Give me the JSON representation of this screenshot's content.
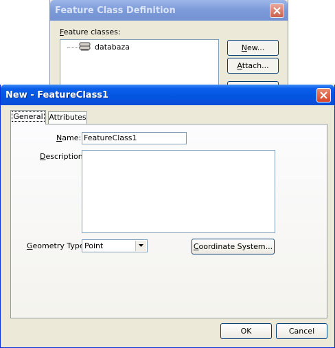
{
  "background_dialog": {
    "title": "Feature Class Definition",
    "feature_classes_label_u": "F",
    "feature_classes_label_rest": "eature classes:",
    "tree_items": [
      "databaza"
    ],
    "new_button_u": "N",
    "new_button_rest": "ew...",
    "attach_button_u": "A",
    "attach_button_rest": "ttach..."
  },
  "main_dialog": {
    "title": "New - FeatureClass1",
    "tabs": [
      {
        "label": "General",
        "selected": true
      },
      {
        "label": "Attributes",
        "selected": false
      }
    ],
    "name_label_u": "N",
    "name_label_rest": "ame:",
    "name_value": "FeatureClass1",
    "description_label_u": "D",
    "description_label_rest": "escription:",
    "description_value": "",
    "geometry_label_u": "G",
    "geometry_label_rest": "eometry Type:",
    "geometry_value": "Point",
    "coord_button_u": "C",
    "coord_button_rest": "oordinate System...",
    "ok_button": "OK",
    "cancel_button": "Cancel"
  },
  "icons": {
    "close": "close-icon",
    "database": "database-icon",
    "dropdown": "chevron-down-icon"
  },
  "colors": {
    "dialog_bg": "#ece9d8",
    "active_titlebar": "#0355e0",
    "inactive_titlebar": "#7c9ad8"
  }
}
